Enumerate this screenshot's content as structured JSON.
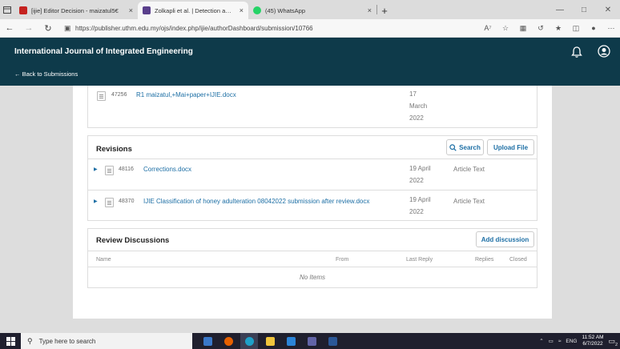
{
  "browser": {
    "tabs": [
      {
        "title": "[ijie] Editor Decision - maizatul5€",
        "active": false,
        "favicon_color": "#c5221f",
        "close": "×"
      },
      {
        "title": "Zolkapli et al. | Detection and Cla",
        "active": true,
        "favicon_color": "#5a3f8c",
        "close": "×"
      },
      {
        "title": "(45) WhatsApp",
        "active": false,
        "favicon_color": "#25d366",
        "close": "×"
      }
    ],
    "new_tab": "+",
    "url": "https://publisher.uthm.edu.my/ojs/index.php/ijie/authorDashboard/submission/10766"
  },
  "header": {
    "journal_title": "International Journal of Integrated Engineering",
    "back_link": "← Back to Submissions"
  },
  "top_file": {
    "id": "47256",
    "name": "R1 maizatul,+Mai+paper+IJIE.docx",
    "date_lines": [
      "17",
      "March",
      "2022"
    ]
  },
  "revisions": {
    "title": "Revisions",
    "search_label": "Search",
    "upload_label": "Upload File",
    "files": [
      {
        "id": "48116",
        "name": "Corrections.docx",
        "date_lines": [
          "19 April",
          "2022"
        ],
        "type": "Article Text"
      },
      {
        "id": "48370",
        "name": "IJIE Classification of honey adulteration 08042022 submission after review.docx",
        "date_lines": [
          "19 April",
          "2022"
        ],
        "type": "Article Text"
      }
    ]
  },
  "discussions": {
    "title": "Review Discussions",
    "add_label": "Add discussion",
    "columns": [
      "Name",
      "From",
      "Last Reply",
      "Replies",
      "Closed"
    ],
    "empty_text": "No Items"
  },
  "taskbar": {
    "search_placeholder": "Type here to search",
    "lang": "ENG",
    "time": "11:52 AM",
    "date": "6/7/2022",
    "notification_count": "2"
  },
  "colors": {
    "header_bg": "#0e3a4a",
    "link": "#1d6fa5",
    "taskbar_bg": "#1f1f2e"
  }
}
